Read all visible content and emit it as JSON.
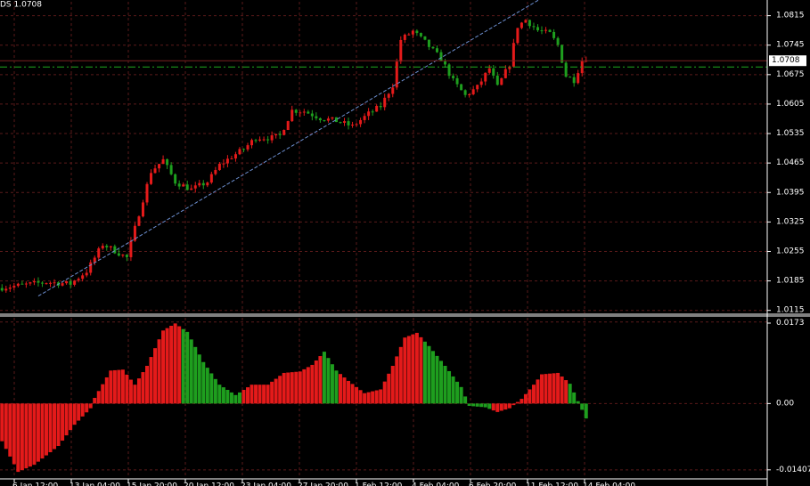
{
  "header": {
    "text": "DS 1.0708"
  },
  "colors": {
    "background": "#000000",
    "grid": "#5a1a1a",
    "frame": "#ffffff",
    "bull": "#e41a1a",
    "bear": "#1e9e1e",
    "trendline": "#6d8fd0",
    "price_line": "#1faa1f"
  },
  "chart_data": [
    {
      "type": "candlestick",
      "title": "",
      "y_ticks": [
        "1.0815",
        "1.0745",
        "1.0708",
        "1.0675",
        "1.0605",
        "1.0535",
        "1.0465",
        "1.0395",
        "1.0325",
        "1.0255",
        "1.0185",
        "1.0115"
      ],
      "x_ticks": [
        "6 Jan 12:00",
        "13 Jan 04:00",
        "15 Jan 20:00",
        "20 Jan 12:00",
        "23 Jan 04:00",
        "27 Jan 20:00",
        "1 Feb 12:00",
        "4 Feb 04:00",
        "6 Feb 20:00",
        "11 Feb 12:00",
        "14 Feb 04:00"
      ],
      "ylim": [
        1.0108,
        1.0848
      ],
      "current_price": 1.0708,
      "price_label": "1.0708",
      "horizontal_line": 1.0693,
      "trendline": {
        "from": [
          9,
          1.0149
        ],
        "to": [
          136,
          1.0868
        ]
      },
      "anchors": [
        [
          0,
          1.0168
        ],
        [
          12,
          1.0182
        ],
        [
          18,
          1.0178
        ],
        [
          22,
          1.0208
        ],
        [
          26,
          1.0272
        ],
        [
          28,
          1.0262
        ],
        [
          32,
          1.024
        ],
        [
          35,
          1.0345
        ],
        [
          38,
          1.0445
        ],
        [
          41,
          1.0472
        ],
        [
          44,
          1.042
        ],
        [
          48,
          1.0402
        ],
        [
          52,
          1.042
        ],
        [
          55,
          1.046
        ],
        [
          58,
          1.048
        ],
        [
          61,
          1.0498
        ],
        [
          64,
          1.0525
        ],
        [
          68,
          1.0525
        ],
        [
          70,
          1.053
        ],
        [
          73,
          1.059
        ],
        [
          76,
          1.0588
        ],
        [
          80,
          1.0572
        ],
        [
          84,
          1.0565
        ],
        [
          88,
          1.0552
        ],
        [
          92,
          1.0582
        ],
        [
          95,
          1.06
        ],
        [
          98,
          1.065
        ],
        [
          100,
          1.0758
        ],
        [
          103,
          1.0778
        ],
        [
          106,
          1.0752
        ],
        [
          110,
          1.0712
        ],
        [
          113,
          1.066
        ],
        [
          116,
          1.0625
        ],
        [
          119,
          1.0645
        ],
        [
          122,
          1.069
        ],
        [
          124,
          1.0645
        ],
        [
          127,
          1.07
        ],
        [
          129,
          1.079
        ],
        [
          131,
          1.0805
        ],
        [
          134,
          1.078
        ],
        [
          137,
          1.0772
        ],
        [
          139,
          1.0745
        ],
        [
          141,
          1.0672
        ],
        [
          143,
          1.0662
        ],
        [
          145,
          1.0708
        ]
      ]
    },
    {
      "type": "histogram",
      "title": "",
      "y_ticks": [
        "0.0173",
        "0.00",
        "-0.01407"
      ],
      "ylim": [
        -0.0158,
        0.0182
      ],
      "anchors": [
        [
          0,
          -0.008
        ],
        [
          4,
          -0.0145
        ],
        [
          8,
          -0.013
        ],
        [
          14,
          -0.009
        ],
        [
          18,
          -0.0045
        ],
        [
          22,
          -0.001
        ],
        [
          23,
          0.0012
        ],
        [
          27,
          0.007
        ],
        [
          30,
          0.0072
        ],
        [
          33,
          0.004
        ],
        [
          36,
          0.008
        ],
        [
          40,
          0.0155
        ],
        [
          43,
          0.017
        ],
        [
          46,
          0.0152
        ],
        [
          50,
          0.0088
        ],
        [
          54,
          0.004
        ],
        [
          58,
          0.0018
        ],
        [
          62,
          0.004
        ],
        [
          66,
          0.004
        ],
        [
          70,
          0.0065
        ],
        [
          74,
          0.0068
        ],
        [
          77,
          0.0082
        ],
        [
          80,
          0.011
        ],
        [
          83,
          0.007
        ],
        [
          86,
          0.0048
        ],
        [
          90,
          0.0022
        ],
        [
          94,
          0.003
        ],
        [
          97,
          0.008
        ],
        [
          100,
          0.014
        ],
        [
          103,
          0.015
        ],
        [
          106,
          0.0122
        ],
        [
          110,
          0.008
        ],
        [
          114,
          0.0035
        ],
        [
          116,
          -0.0005
        ],
        [
          120,
          -0.0008
        ],
        [
          123,
          -0.0018
        ],
        [
          126,
          -0.001
        ],
        [
          129,
          0.001
        ],
        [
          132,
          0.004
        ],
        [
          134,
          0.0062
        ],
        [
          138,
          0.0065
        ],
        [
          141,
          0.0042
        ],
        [
          143,
          0.0005
        ],
        [
          146,
          -0.005
        ]
      ],
      "bull_ranges": [
        [
          0,
          21
        ],
        [
          22,
          44
        ],
        [
          60,
          79
        ],
        [
          84,
          104
        ],
        [
          122,
          140
        ]
      ]
    }
  ]
}
